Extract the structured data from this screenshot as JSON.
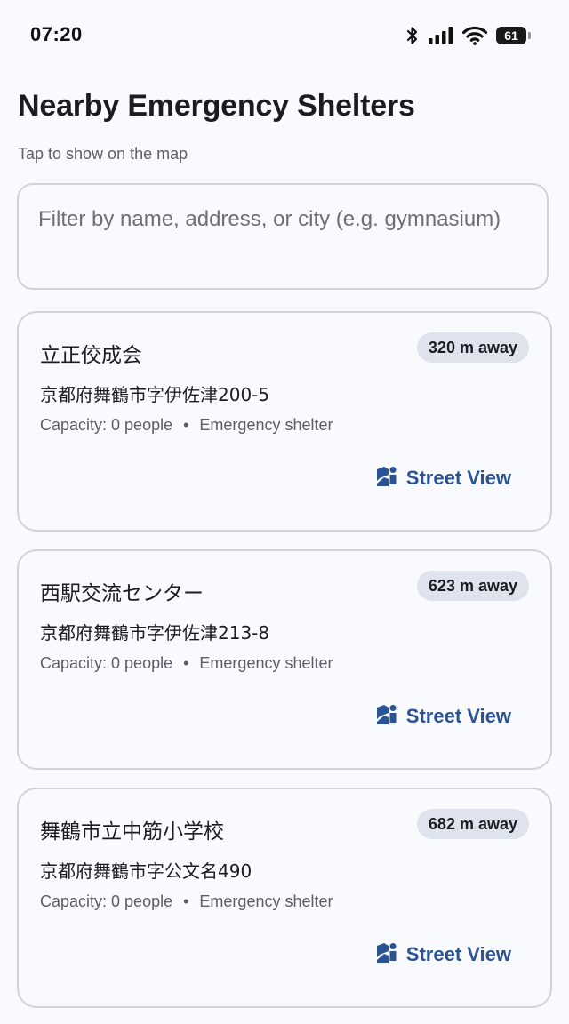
{
  "status_bar": {
    "time": "07:20",
    "battery_level": "61",
    "icons": [
      "bluetooth-icon",
      "signal-icon",
      "wifi-icon",
      "battery-icon"
    ]
  },
  "header": {
    "title": "Nearby Emergency Shelters",
    "subtitle": "Tap to show on the map"
  },
  "filter": {
    "placeholder": "Filter by name, address, or city (e.g. gymnasium)",
    "value": ""
  },
  "colors": {
    "accent": "#2b5293",
    "badge_bg": "#dee3ee",
    "border": "#cfd3da",
    "background": "#f8fafd"
  },
  "shelters": [
    {
      "name": "立正佼成会",
      "distance": "320 m away",
      "address": "京都府舞鶴市字伊佐津200-5",
      "capacity": "Capacity: 0 people",
      "separator": "•",
      "type": "Emergency shelter",
      "action_label": "Street View",
      "action_icon": "street-view-icon"
    },
    {
      "name": "西駅交流センター",
      "distance": "623 m away",
      "address": "京都府舞鶴市字伊佐津213-8",
      "capacity": "Capacity: 0 people",
      "separator": "•",
      "type": "Emergency shelter",
      "action_label": "Street View",
      "action_icon": "street-view-icon"
    },
    {
      "name": "舞鶴市立中筋小学校",
      "distance": "682 m away",
      "address": "京都府舞鶴市字公文名490",
      "capacity": "Capacity: 0 people",
      "separator": "•",
      "type": "Emergency shelter",
      "action_label": "Street View",
      "action_icon": "street-view-icon"
    }
  ]
}
